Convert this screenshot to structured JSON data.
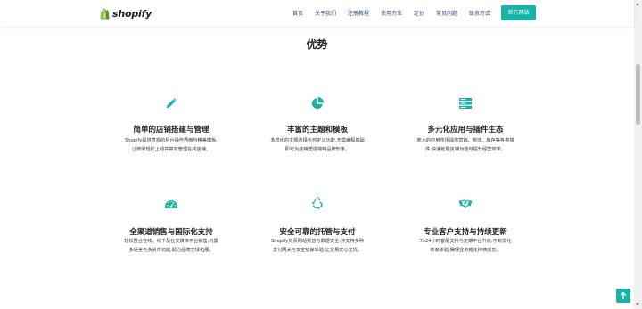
{
  "brand": {
    "name": "shopify",
    "color": "#5e8e3e"
  },
  "nav": {
    "items": [
      "首页",
      "关于我们",
      "注册教程",
      "使用方法",
      "定价",
      "常见问题",
      "联系方式"
    ],
    "cta": "官方网站"
  },
  "section": {
    "title": "优势"
  },
  "features": [
    {
      "icon": "pencil-icon",
      "title": "简单的店铺搭建与管理",
      "desc": [
        "Shopify提供直观的后台操作界面与精美模板,",
        "让商家轻松上线并高效管理在线店铺。"
      ]
    },
    {
      "icon": "pie-chart-icon",
      "title": "丰富的主题和模板",
      "desc": [
        "多样化的主题选择与自定义功能,无需编程基础",
        "即可为店铺塑造独特品牌形象。"
      ]
    },
    {
      "icon": "server-icon",
      "title": "多元化应用与插件生态",
      "desc": [
        "庞大的应用市场提供营销、物流、库存等各类插",
        "件,快速拓展店铺功能与提升经营效率。"
      ]
    },
    {
      "icon": "dashboard-icon",
      "title": "全渠道销售与国际化支持",
      "desc": [
        "轻松整合在线、线下及社交媒体平台销售,内置",
        "多语言与多货币功能,助力品牌全球拓展。"
      ]
    },
    {
      "icon": "recycle-icon",
      "title": "安全可靠的托管与支付",
      "desc": [
        "Shopify负责网站托管与数据安全,并支持多种",
        "支付网关与安全结算体验,让交易安心无忧。"
      ]
    },
    {
      "icon": "handshake-icon",
      "title": "专业客户支持与持续更新",
      "desc": [
        "7x24小时客服支持与定期平台升级,不断优化",
        "商家体验,确保业务稳定持续成长。"
      ]
    }
  ],
  "accent": "#18b3a5",
  "nav_color": "#2d3e7a"
}
